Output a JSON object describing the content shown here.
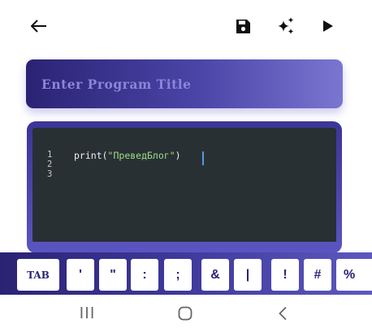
{
  "toolbar": {
    "icons": {
      "back": "arrow-left-icon",
      "save": "floppy-disk-icon",
      "ai": "sparkle-icon",
      "run": "play-icon"
    }
  },
  "title": {
    "placeholder": "Enter Program Title",
    "value": ""
  },
  "editor": {
    "line_numbers": [
      "1",
      "2",
      "3"
    ],
    "code_prefix": "print(",
    "code_string": "\"ПреведБлог\"",
    "code_suffix": ")"
  },
  "keys": [
    "TAB",
    "'",
    "\"",
    ":",
    ";",
    "&",
    "|",
    "!",
    "#",
    "%"
  ],
  "navbar": {
    "icons": [
      "recent-apps-icon",
      "home-icon",
      "back-chevron-icon"
    ]
  },
  "colors": {
    "accent_dark": "#2a2374",
    "accent_light": "#7a76d0",
    "editor_bg": "#283033",
    "string": "#9fdc8a"
  }
}
